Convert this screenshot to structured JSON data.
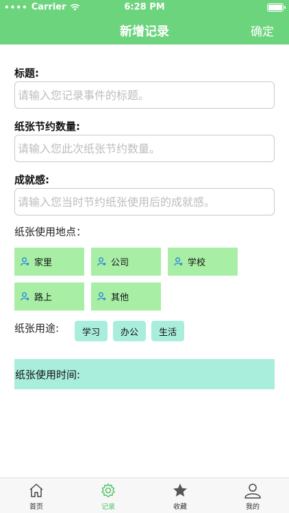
{
  "status_bar": {
    "carrier": "Carrier",
    "time": "6:28 PM"
  },
  "nav": {
    "title": "新增记录",
    "confirm": "确定"
  },
  "form": {
    "title_label": "标题:",
    "title_placeholder": "请输入您记录事件的标题。",
    "paper_label": "纸张节约数量:",
    "paper_placeholder": "请输入您此次纸张节约数量。",
    "feeling_label": "成就感:",
    "feeling_placeholder": "请输入您当时节约纸张使用后的成就感。",
    "location_label": "纸张使用地点：",
    "locations": [
      "家里",
      "公司",
      "学校",
      "路上",
      "其他"
    ],
    "usage_label": "纸张用途:",
    "usages": [
      "学习",
      "办公",
      "生活"
    ],
    "time_label": "纸张使用时间:"
  },
  "tabbar": {
    "items": [
      {
        "label": "首页",
        "icon": "home-icon"
      },
      {
        "label": "记录",
        "icon": "gear-icon"
      },
      {
        "label": "收藏",
        "icon": "star-icon"
      },
      {
        "label": "我的",
        "icon": "user-icon"
      }
    ],
    "active_color": "#54c36a"
  },
  "colors": {
    "header": "#6dd47e",
    "location_button": "#a8eea5",
    "usage_button": "#a9eddc"
  }
}
